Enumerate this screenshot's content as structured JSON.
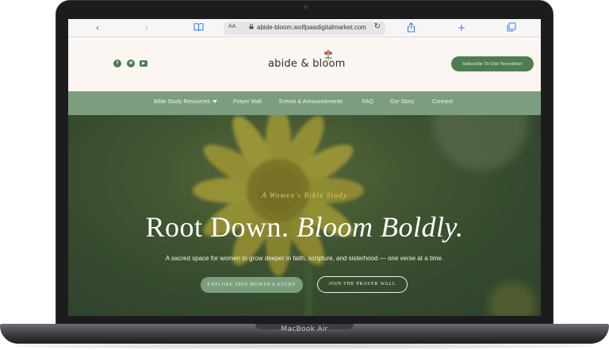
{
  "browser": {
    "url": "abide-bloom.wolfpawdigitalmarket.com",
    "text_size_label": "AA",
    "icons": [
      "back-icon",
      "forward-icon",
      "reader-icon",
      "lock-icon",
      "reload-icon",
      "share-icon",
      "new-tab-icon",
      "tabs-icon"
    ]
  },
  "header": {
    "logo_text": "abide & bloom",
    "social": [
      "facebook-icon",
      "spotify-icon",
      "youtube-icon"
    ],
    "subscribe_label": "Subscribe To Our Newsletter"
  },
  "nav": {
    "items": [
      {
        "label": "Bible Study Resources"
      },
      {
        "label": "Prayer Wall"
      },
      {
        "label": "Events & Announcements"
      },
      {
        "label": "FAQ"
      },
      {
        "label": "Our Story"
      },
      {
        "label": "Connect"
      }
    ]
  },
  "hero": {
    "eyebrow": "A Women's Bible Study",
    "headline_plain": "Root Down.",
    "headline_italic": "Bloom Boldly.",
    "subline": "A sacred space for women to grow deeper in faith, scripture, and sisterhood — one verse at a time.",
    "primary_cta": "EXPLORE THIS MONTH'S STUDY",
    "secondary_cta": "JOIN THE PRAYER WALL"
  },
  "device": {
    "label": "MacBook Air"
  },
  "colors": {
    "brand_green": "#4f7d52",
    "nav_green": "#7c9e7f",
    "cream": "#fbf6f1",
    "accent_yellow": "#e3c96a",
    "link_blue": "#3478f6"
  }
}
